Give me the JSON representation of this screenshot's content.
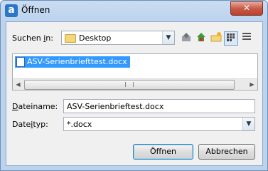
{
  "window": {
    "title": "Öffnen",
    "app_icon_letter": "a",
    "close_glyph": "✕"
  },
  "lookin": {
    "label_pre": "Suchen ",
    "label_ul": "i",
    "label_post": "n:",
    "value": "Desktop"
  },
  "toolbar": {
    "icons": [
      "up-folder-icon",
      "desktop-home-icon",
      "new-folder-icon",
      "list-view-icon",
      "details-view-icon"
    ]
  },
  "files": [
    {
      "name": "ASV-Serienbriefttest.docx"
    }
  ],
  "filename": {
    "label_ul": "D",
    "label_post": "ateiname:",
    "value": "ASV-Serienbrieftest.docx"
  },
  "filetype": {
    "label_pre": "Date",
    "label_ul": "i",
    "label_post": "typ:",
    "value": "*.docx"
  },
  "buttons": {
    "open": "Öffnen",
    "cancel": "Abbrechen"
  },
  "colors": {
    "selection": "#3399ff",
    "close_button": "#c75a46",
    "frame": "#bcd3ee"
  }
}
